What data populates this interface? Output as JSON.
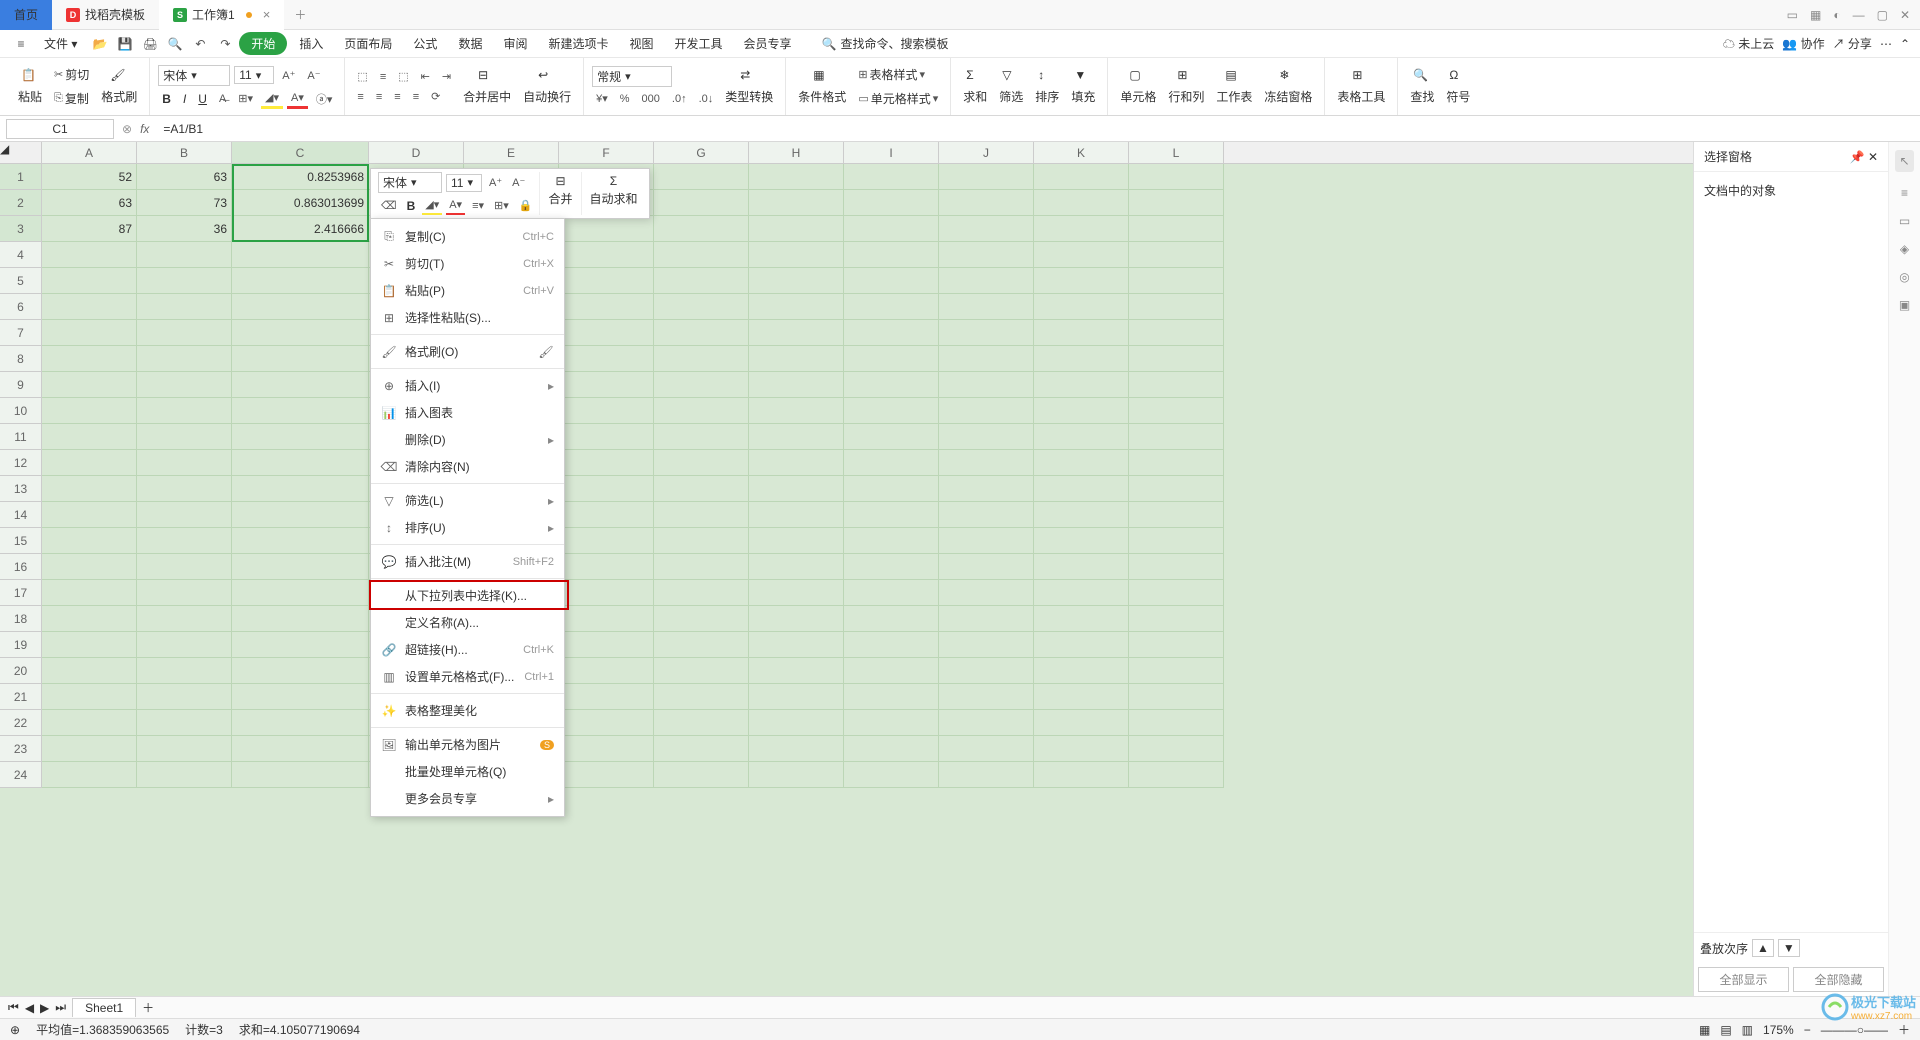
{
  "tabs": {
    "home": "首页",
    "tpl": "找稻壳模板",
    "book": "工作簿1"
  },
  "menubar": {
    "file": "文件",
    "start": "开始",
    "insert": "插入",
    "layout": "页面布局",
    "formula": "公式",
    "data": "数据",
    "review": "审阅",
    "newtab": "新建选项卡",
    "view": "视图",
    "dev": "开发工具",
    "member": "会员专享",
    "search_ph": "查找命令、搜索模板",
    "cloud": "未上云",
    "collab": "协作",
    "share": "分享"
  },
  "ribbon": {
    "paste": "粘贴",
    "cut": "剪切",
    "copy": "复制",
    "fmtpainter": "格式刷",
    "font": "宋体",
    "size": "11",
    "merge": "合并居中",
    "wrap": "自动换行",
    "numfmt": "常规",
    "typeconv": "类型转换",
    "condfmt": "条件格式",
    "tablestyle": "表格样式",
    "cellstyle": "单元格样式",
    "sum": "求和",
    "filter": "筛选",
    "sort": "排序",
    "fill": "填充",
    "cell": "单元格",
    "rowcol": "行和列",
    "worksheet": "工作表",
    "freeze": "冻结窗格",
    "tabletool": "表格工具",
    "find": "查找",
    "symbol": "符号"
  },
  "namebox": "C1",
  "formula": "=A1/B1",
  "columns": [
    "A",
    "B",
    "C",
    "D",
    "E",
    "F",
    "G",
    "H",
    "I",
    "J",
    "K",
    "L"
  ],
  "rows": [
    1,
    2,
    3,
    4,
    5,
    6,
    7,
    8,
    9,
    10,
    11,
    12,
    13,
    14,
    15,
    16,
    17,
    18,
    19,
    20,
    21,
    22,
    23,
    24
  ],
  "cells": {
    "A1": "52",
    "B1": "63",
    "C1": "0.8253968",
    "A2": "63",
    "B2": "73",
    "C2": "0.863013699",
    "A3": "87",
    "B3": "36",
    "C3": "2.416666"
  },
  "minitoolbar": {
    "font": "宋体",
    "size": "11",
    "merge": "合并",
    "sum": "自动求和"
  },
  "context": {
    "copy": "复制(C)",
    "copy_k": "Ctrl+C",
    "cut": "剪切(T)",
    "cut_k": "Ctrl+X",
    "paste": "粘贴(P)",
    "paste_k": "Ctrl+V",
    "pspecial": "选择性粘贴(S)...",
    "fmtpaint": "格式刷(O)",
    "insert": "插入(I)",
    "chart": "插入图表",
    "delete": "删除(D)",
    "clear": "清除内容(N)",
    "filter": "筛选(L)",
    "sort": "排序(U)",
    "comment": "插入批注(M)",
    "comment_k": "Shift+F2",
    "dropdown": "从下拉列表中选择(K)...",
    "defname": "定义名称(A)...",
    "hyperlink": "超链接(H)...",
    "hyperlink_k": "Ctrl+K",
    "cellfmt": "设置单元格格式(F)...",
    "cellfmt_k": "Ctrl+1",
    "beautify": "表格整理美化",
    "exportimg": "输出单元格为图片",
    "batch": "批量处理单元格(Q)",
    "moremember": "更多会员专享"
  },
  "sidepanel": {
    "title": "选择窗格",
    "objects": "文档中的对象",
    "stack": "叠放次序",
    "showall": "全部显示",
    "hideall": "全部隐藏"
  },
  "tabs_bottom": {
    "sheet": "Sheet1"
  },
  "status": {
    "avg": "平均值=1.368359063565",
    "count": "计数=3",
    "sum": "求和=4.105077190694",
    "zoom": "175%"
  },
  "watermark": {
    "text": "极光下载站",
    "url": "www.xz7.com"
  }
}
